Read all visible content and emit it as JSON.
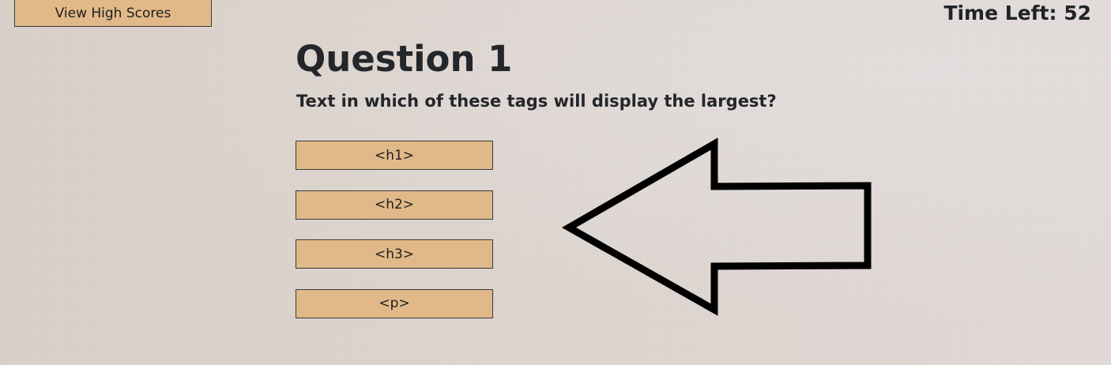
{
  "header": {
    "high_scores_label": "View High Scores",
    "timer_label": "Time Left:",
    "timer_value": "52"
  },
  "question": {
    "title": "Question 1",
    "text": "Text in which of these tags will display the largest?"
  },
  "answers": [
    {
      "label": "<h1>"
    },
    {
      "label": "<h2>"
    },
    {
      "label": "<h3>"
    },
    {
      "label": "<p>"
    }
  ],
  "colors": {
    "button_fill": "#e1b989",
    "button_border": "#3a3a3a",
    "text": "#23262a",
    "arrow_stroke": "#000000"
  },
  "icons": {
    "pointer": "left-arrow-outline-icon"
  }
}
